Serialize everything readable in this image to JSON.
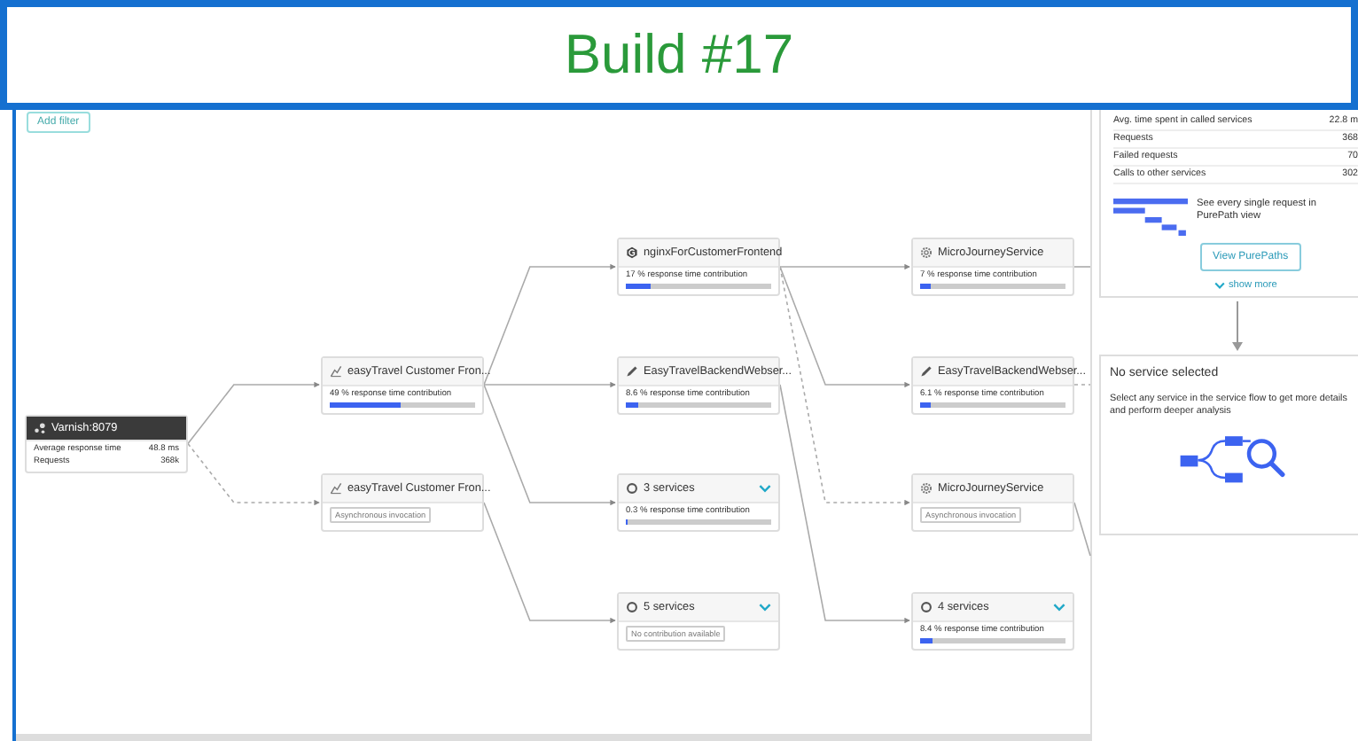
{
  "banner": {
    "title": "Build #17"
  },
  "toolbar": {
    "add_filter": "Add filter"
  },
  "flow": {
    "columns": [
      [
        {
          "kind": "root",
          "title": "Varnish:8079",
          "stats": [
            {
              "label": "Average response time",
              "value": "48.8 ms"
            },
            {
              "label": "Requests",
              "value": "368k"
            }
          ]
        }
      ],
      [
        {
          "kind": "contribution",
          "title": "easyTravel Customer Fron...",
          "contribution": "49 % response time contribution",
          "level": 0.49
        },
        {
          "kind": "badge",
          "title": "easyTravel Customer Fron...",
          "badge": "Asynchronous invocation"
        }
      ],
      [
        {
          "kind": "contribution",
          "title": "nginxForCustomerFrontend",
          "contribution": "17 % response time contribution",
          "level": 0.17
        },
        {
          "kind": "contribution",
          "title": "EasyTravelBackendWebser...",
          "contribution": "8.6 % response time contribution",
          "level": 0.09
        },
        {
          "kind": "contribution",
          "title": "3 services",
          "contribution": "0.3 % response time contribution",
          "level": 0.01,
          "expandable": true
        },
        {
          "kind": "badge",
          "title": "5 services",
          "badge": "No contribution available",
          "expandable": true
        }
      ],
      [
        {
          "kind": "contribution",
          "title": "MicroJourneyService",
          "contribution": "7 % response time contribution",
          "level": 0.07
        },
        {
          "kind": "contribution",
          "title": "EasyTravelBackendWebser...",
          "contribution": "6.1 % response time contribution",
          "level": 0.07
        },
        {
          "kind": "badge",
          "title": "MicroJourneyService",
          "badge": "Asynchronous invocation"
        },
        {
          "kind": "contribution",
          "title": "4 services",
          "contribution": "8.4 % response time contribution",
          "level": 0.08,
          "expandable": true
        }
      ]
    ]
  },
  "details": {
    "rows": [
      {
        "label": "Avg. time spent in called services",
        "value": "22.8 m"
      },
      {
        "label": "Requests",
        "value": "368"
      },
      {
        "label": "Failed requests",
        "value": "70"
      },
      {
        "label": "Calls to other services",
        "value": "302"
      }
    ],
    "purepaths_text": "See every single request in PurePath view",
    "purepaths_button": "View PurePaths",
    "show_more": "show more"
  },
  "selection": {
    "title": "No service selected",
    "text": "Select any service in the service flow to get more details and perform deeper analysis"
  }
}
